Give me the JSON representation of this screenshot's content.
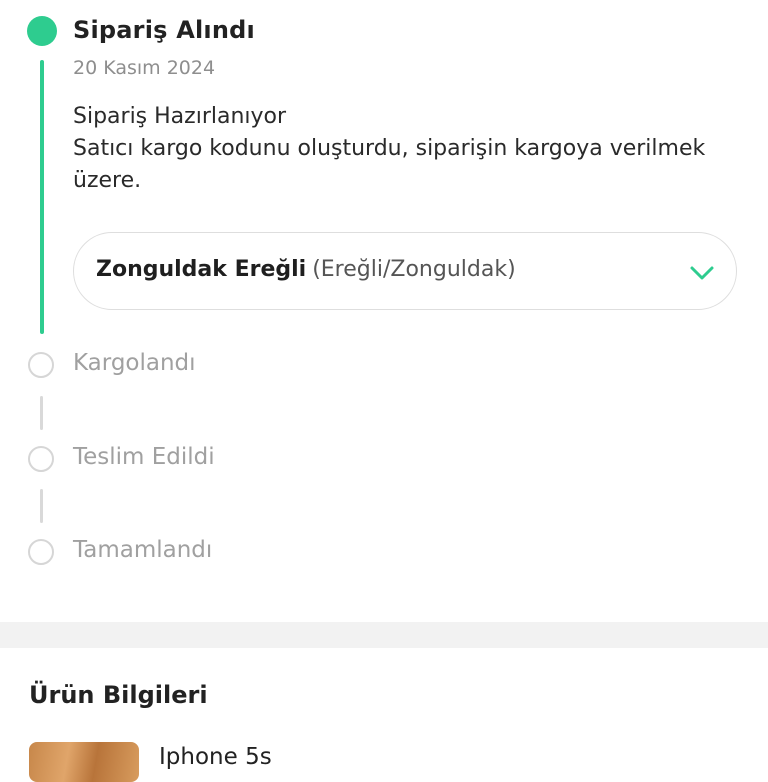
{
  "timeline": {
    "current_step": {
      "title": "Sipariş Alındı",
      "date": "20 Kasım 2024",
      "status_title": "Sipariş Hazırlanıyor",
      "status_detail": "Satıcı kargo kodunu oluşturdu, siparişin kargoya verilmek üzere."
    },
    "location": {
      "city": "Zonguldak Ereğli",
      "detail": "(Ereğli/Zonguldak)"
    },
    "pending_steps": [
      "Kargolandı",
      "Teslim Edildi",
      "Tamamlandı"
    ]
  },
  "product_section": {
    "title": "Ürün Bilgileri",
    "product_name": "Iphone 5s"
  },
  "colors": {
    "accent": "#2ecc8f",
    "inactive": "#d6d6d6"
  },
  "icons": {
    "active_step": "filled-circle",
    "pending_step": "empty-circle",
    "expand": "chevron-down-icon"
  }
}
